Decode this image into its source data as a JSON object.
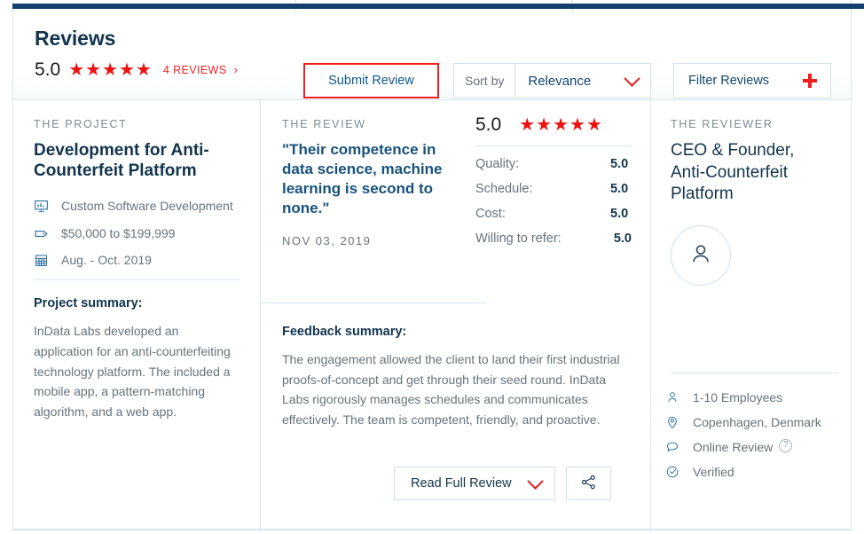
{
  "header": {
    "title": "Reviews",
    "score": "5.0",
    "stars": 5,
    "reviews_count_label": "4 REVIEWS",
    "chevron": "›",
    "submit_button": "Submit Review",
    "sort_label": "Sort by",
    "sort_value": "Relevance",
    "filter_label": "Filter Reviews"
  },
  "project": {
    "eyebrow": "THE PROJECT",
    "title": "Development for Anti-Counterfeit Platform",
    "meta": [
      {
        "icon": "service-chart-icon",
        "text": "Custom Software Development"
      },
      {
        "icon": "price-tag-icon",
        "text": "$50,000 to $199,999"
      },
      {
        "icon": "calendar-icon",
        "text": "Aug. - Oct. 2019"
      }
    ],
    "summary_heading": "Project summary:",
    "summary_text": "InData Labs developed an application for an anti-counterfeiting technology platform. The included a mobile app, a pattern-matching algorithm, and a web app."
  },
  "review": {
    "eyebrow": "THE REVIEW",
    "quote": "\"Their competence in data science, machine learning is second to none.\"",
    "date": "NOV 03, 2019",
    "feedback_heading": "Feedback summary:",
    "feedback_text": "The engagement allowed the client to land their first industrial proofs-of-concept and get through their seed round. InData Labs rigorously manages schedules and communicates effectively. The team is competent, friendly, and proactive.",
    "read_full_label": "Read Full Review",
    "share_icon": "share-icon"
  },
  "ratings": {
    "overall": "5.0",
    "stars": 5,
    "rows": [
      {
        "label": "Quality:",
        "value": "5.0"
      },
      {
        "label": "Schedule:",
        "value": "5.0"
      },
      {
        "label": "Cost:",
        "value": "5.0"
      },
      {
        "label": "Willing to refer:",
        "value": "5.0"
      }
    ]
  },
  "reviewer": {
    "eyebrow": "THE REVIEWER",
    "title": "CEO & Founder, Anti-Counterfeit Platform",
    "avatar_icon": "person-avatar-icon",
    "details": [
      {
        "icon": "person-icon",
        "text": "1-10 Employees",
        "help": false
      },
      {
        "icon": "location-pin-icon",
        "text": "Copenhagen, Denmark",
        "help": false
      },
      {
        "icon": "speech-bubble-icon",
        "text": "Online Review",
        "help": true
      },
      {
        "icon": "verified-check-icon",
        "text": "Verified",
        "help": false
      }
    ],
    "help_glyph": "?"
  },
  "colors": {
    "navy_bar": "#104070",
    "star_red": "#ee1111",
    "accent_red": "#f21f1f",
    "heading_navy": "#12344d",
    "link_blue": "#12466e",
    "border_light": "#d6e6ef",
    "muted_text": "#66737d"
  }
}
